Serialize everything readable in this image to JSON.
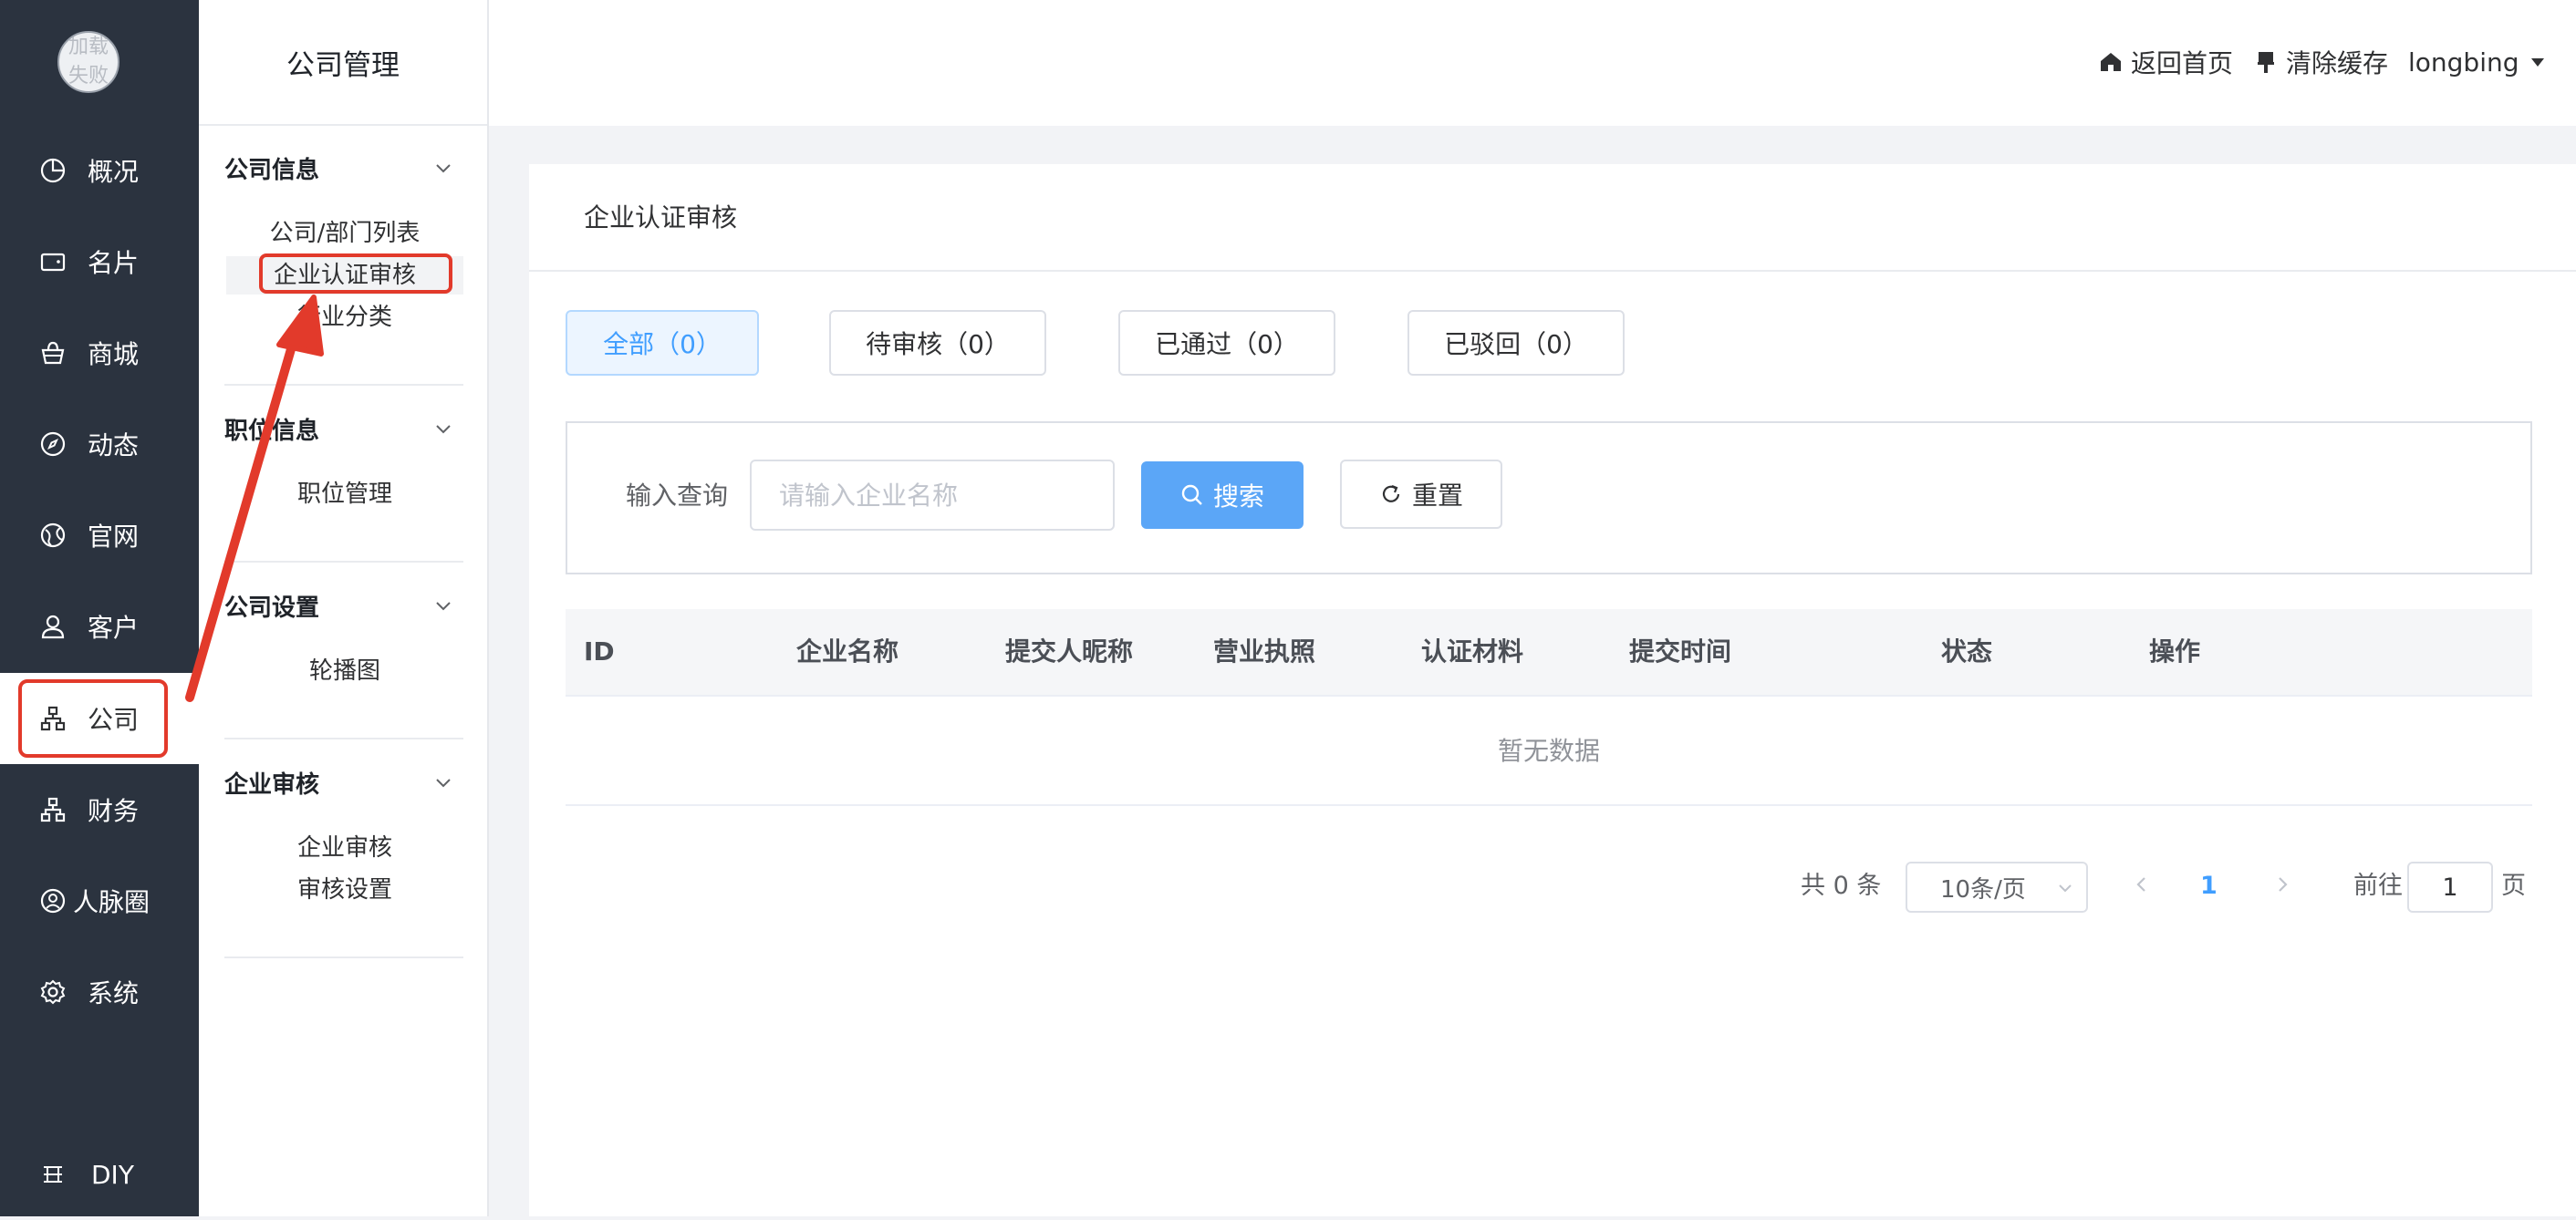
{
  "nav": {
    "avatar_text": "加载失败",
    "items": [
      {
        "label": "概况",
        "icon": "pie-chart-icon"
      },
      {
        "label": "名片",
        "icon": "wallet-icon"
      },
      {
        "label": "商城",
        "icon": "shopping-basket-icon"
      },
      {
        "label": "动态",
        "icon": "compass-icon"
      },
      {
        "label": "官网",
        "icon": "globe-icon"
      },
      {
        "label": "客户",
        "icon": "user-icon"
      },
      {
        "label": "公司",
        "icon": "org-chart-icon"
      },
      {
        "label": "财务",
        "icon": "org-chart-icon"
      },
      {
        "label": "人脉圈",
        "icon": "user-circle-icon"
      },
      {
        "label": "系统",
        "icon": "gear-icon"
      }
    ],
    "active": "公司",
    "diy_label": "DIY"
  },
  "submenu": {
    "title": "公司管理",
    "groups": [
      {
        "title": "公司信息",
        "items": [
          "公司/部门列表",
          "企业认证审核",
          "行业分类"
        ]
      },
      {
        "title": "职位信息",
        "items": [
          "职位管理"
        ]
      },
      {
        "title": "公司设置",
        "items": [
          "轮播图"
        ]
      },
      {
        "title": "企业审核",
        "items": [
          "企业审核",
          "审核设置"
        ]
      }
    ],
    "active_item": "企业认证审核"
  },
  "header": {
    "home_label": "返回首页",
    "clear_cache_label": "清除缓存",
    "username": "longbing"
  },
  "main": {
    "card_title": "企业认证审核",
    "tabs": [
      "全部（0）",
      "待审核（0）",
      "已通过（0）",
      "已驳回（0）"
    ],
    "active_tab": "全部（0）",
    "filter": {
      "label": "输入查询",
      "placeholder": "请输入企业名称",
      "value": "",
      "search_label": "搜索",
      "reset_label": "重置"
    },
    "table": {
      "columns": [
        "ID",
        "企业名称",
        "提交人昵称",
        "营业执照",
        "认证材料",
        "提交时间",
        "状态",
        "操作"
      ],
      "rows": [],
      "empty_text": "暂无数据"
    },
    "pagination": {
      "total_text": "共 0 条",
      "page_size": "10条/页",
      "current_page": "1",
      "goto_prefix": "前往",
      "goto_value": "1",
      "goto_suffix": "页"
    }
  },
  "colors": {
    "nav_bg": "#2b333f",
    "accent": "#409eff",
    "search_button": "#5ba6f7",
    "annotation": "#e23a2b"
  }
}
